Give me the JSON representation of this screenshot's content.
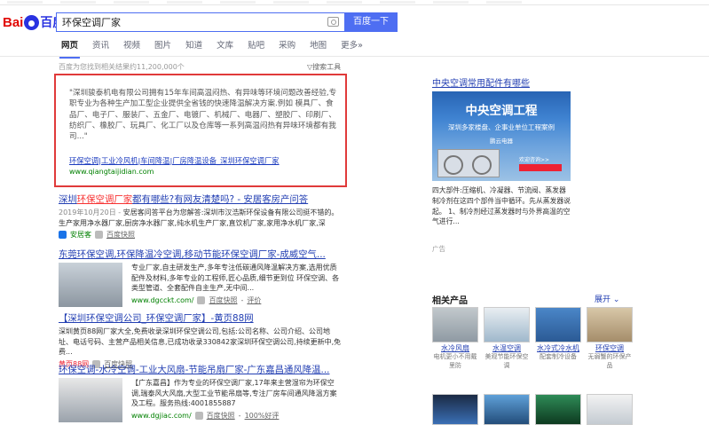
{
  "logo": {
    "part1": "Bai",
    "part2": "百度"
  },
  "search": {
    "value": "环保空调厂家",
    "button": "百度一下"
  },
  "tabs": [
    "网页",
    "资讯",
    "视频",
    "图片",
    "知道",
    "文库",
    "贴吧",
    "采购",
    "地图",
    "更多»"
  ],
  "result_count": "百度为您找到相关结果约11,200,000个",
  "search_tools": "搜索工具",
  "ad": {
    "text": "\"深圳骏泰机电有限公司拥有15年车间高温闷热、有异味等环境问题改善经验,专职专业为各种生产加工型企业提供全省钱的快速降温解决方案.例如 模具厂、食品厂、电子厂、服装厂、五金厂、电镀厂、机械厂、电器厂、塑胶厂、印刷厂、纺织厂、橡胶厂、玩具厂、化工厂以及仓库等一系列高温闷热有异味环境都有我司...\"",
    "link": "环保空调|工业冷风机|车间降温|厂房降温设备_深圳环保空调厂家",
    "url": "www.qiangtaijidian.com"
  },
  "results": [
    {
      "title_pre": "深圳",
      "title_em": "环保空调厂家",
      "title_post": "都有哪些?有网友清楚吗? - 安居客房产问答",
      "date": "2019年10月20日 - ",
      "desc": "安居客问答平台为您解答:深圳市汉浩斯环保设备有限公司挺不错的。生产家用净水器厂家,厨房净水器厂家,纯水机生产厂家,直饮机厂家,家用净水机厂家,深",
      "meta_site": "安居客",
      "meta_snap": "百度快照"
    },
    {
      "title": "东莞环保空调,环保降温冷空调,移动节能环保空调厂家-成威空气...",
      "desc": "专业厂家,自主研发生产,多年专注低碳通风降温解决方案,选用优质配件及材料,多年专业的工程师,匠心品质,细节更到位 环保空调、各类型管道、全套配件自主生产,无中间...",
      "url": "www.dgcckt.com/",
      "snap": "百度快照",
      "eval": "评价"
    },
    {
      "title": "【深圳环保空调公司_环保空调厂家】-黄页88网",
      "desc": "深圳黄页88网厂家大全,免费收录深圳环保空调公司,包括:公司名称、公司介绍、公司地址、电话号码、主营产品相关信息,已成功收录330842家深圳环保空调公司,持续更新中,免费...",
      "url": "黄页88网",
      "snap": "百度快照"
    },
    {
      "title": "环保空调-水冷空调-工业大风扇-节能吊扇厂家-广东嘉昌通风降温...",
      "desc": "【广东嘉昌】作为专业的环保空调厂家,17年来主营湿帘为环保空调,瑞泰风大风扇,大型工业节能吊扇等,专注厂房车间通风降温方案及工程。服务热线:4001855887",
      "url": "www.dgjiac.com/",
      "snap": "百度快照",
      "eval": "100%好评"
    }
  ],
  "right": {
    "title": "中央空调常用配件有哪些",
    "img_h1": "中央空调工程",
    "img_h2": "深圳多家楼盘、企事业单位工程案例",
    "img_h3": "鹏云电器",
    "img_consult": "欢迎咨询>>",
    "desc": "四大部件:压缩机、冷凝器、节流阀、蒸发器 制冷剂在这四个部件当中循环。先从蒸发器说起。 1、制冷剂经过蒸发器时与外界高温的空气进行...",
    "ad_label": "广告"
  },
  "related": {
    "title": "相关产品",
    "expand": "展开",
    "items": [
      {
        "name": "水冷风扇",
        "sub": "电机更小不用戴里防"
      },
      {
        "name": "水温空调",
        "sub": "美观节能环保空调"
      },
      {
        "name": "水冷式冷水机",
        "sub": "配套制冷设备"
      },
      {
        "name": "环保空调",
        "sub": "无弱蟹的环保产品"
      }
    ]
  }
}
